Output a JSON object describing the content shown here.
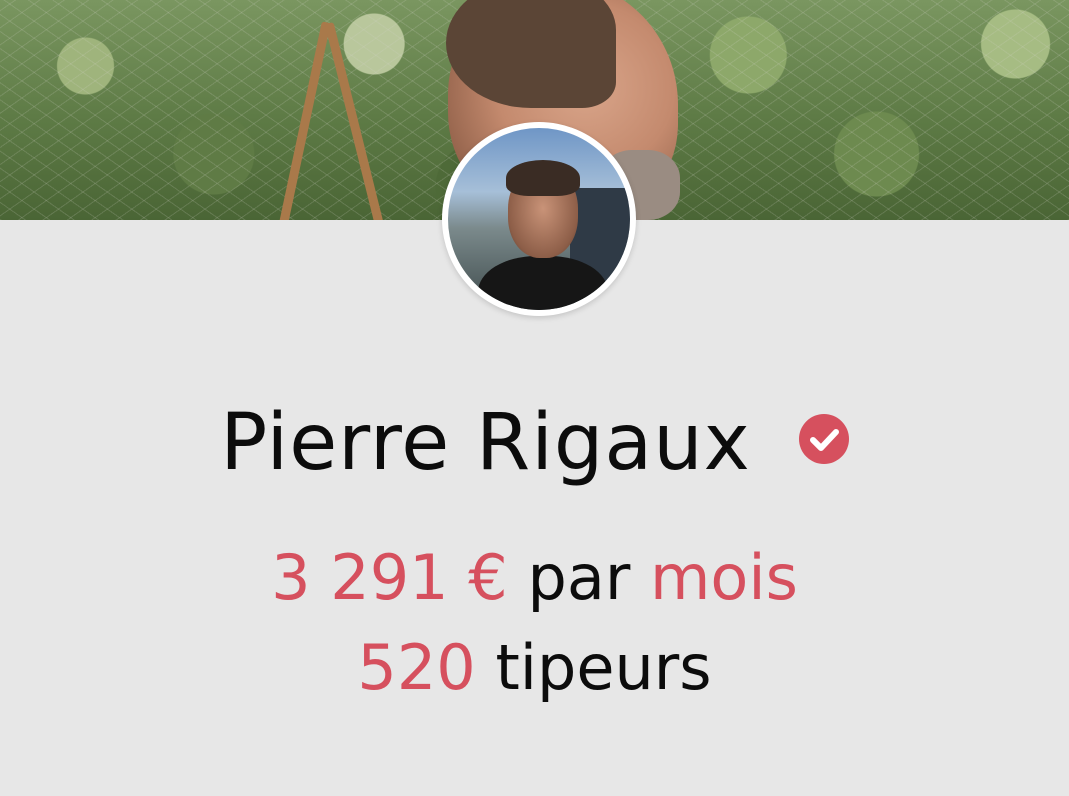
{
  "profile": {
    "name": "Pierre Rigaux",
    "verified_icon": "check-circle-icon",
    "monthly_amount": "3 291 €",
    "monthly_connector": "par",
    "monthly_period": "mois",
    "tipers_count": "520",
    "tipers_label": "tipeurs"
  },
  "colors": {
    "accent": "#d6505e",
    "text": "#0c0c0c",
    "background": "#e7e7e7"
  }
}
